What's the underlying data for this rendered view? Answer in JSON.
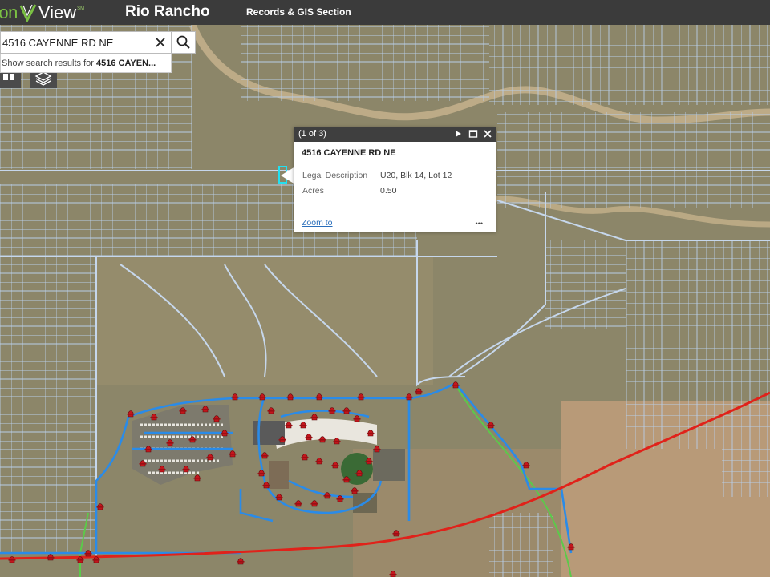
{
  "header": {
    "brand_left": "ion",
    "brand_right": "View",
    "brand_mark": "SM",
    "city": "Rio Rancho",
    "section": "Records & GIS Section"
  },
  "search": {
    "value": "4516 CAYENNE RD NE",
    "suggestion_prefix": "Show search results for ",
    "suggestion_term": "4516 CAYEN..."
  },
  "popup": {
    "counter": "(1 of 3)",
    "title": "4516 CAYENNE RD NE",
    "fields": [
      {
        "label": "Legal Description",
        "value": "U20, Blk 14, Lot 12"
      },
      {
        "label": "Acres",
        "value": "0.50"
      }
    ],
    "zoom_label": "Zoom to",
    "more_label": "•••"
  },
  "colors": {
    "header_bg": "#3b3b3b",
    "brand_green": "#7bc143",
    "parcel_line": "#b9cde6",
    "water_line": "#2a8be8",
    "highway": "#e0221a",
    "hydrant": "#c4161c",
    "green_line": "#5cc94a",
    "popup_link": "#2a6ebb"
  },
  "icons": [
    "close-icon",
    "search-icon",
    "basemap-icon",
    "layers-icon",
    "next-icon",
    "maximize-icon",
    "close-popup-icon",
    "more-icon",
    "fire-hydrant-icon"
  ]
}
